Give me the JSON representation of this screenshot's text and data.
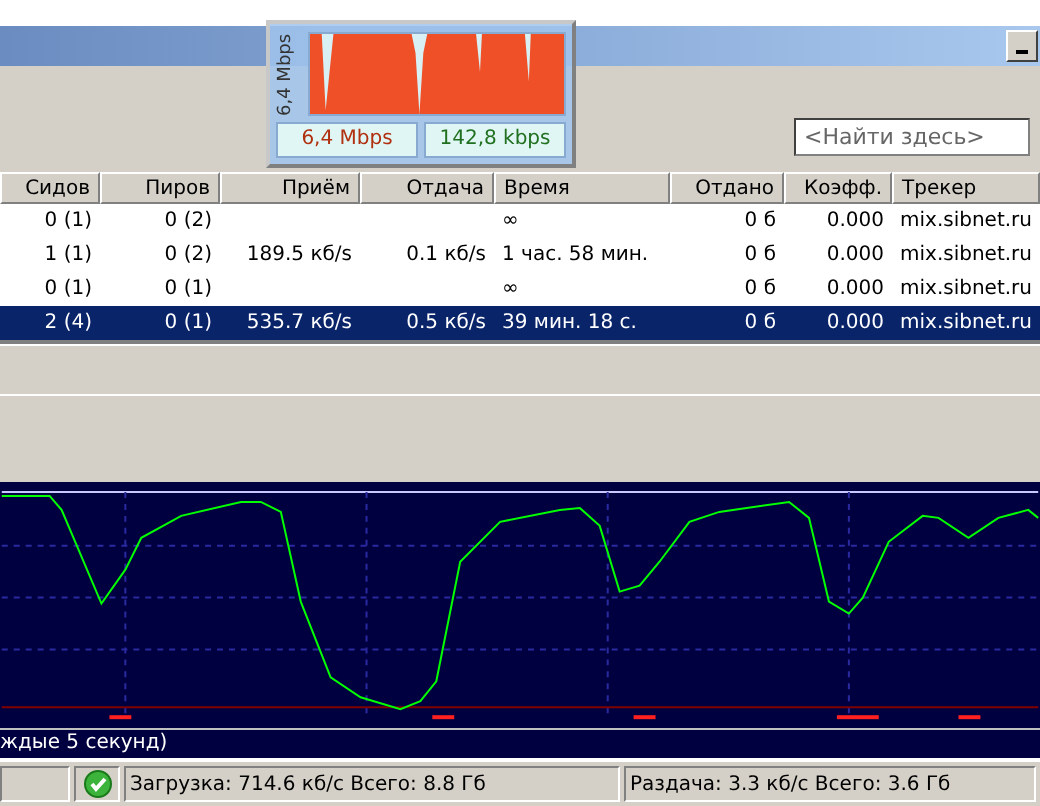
{
  "speed_widget": {
    "axis_label": "6,4 Mbps",
    "download": "6,4 Mbps",
    "upload": "142,8 kbps"
  },
  "search": {
    "placeholder": "<Найти здесь>"
  },
  "table": {
    "columns": [
      "Сидов",
      "Пиров",
      "Приём",
      "Отдача",
      "Время",
      "Отдано",
      "Коэфф.",
      "Трекер"
    ],
    "rows": [
      {
        "cells": [
          "0 (1)",
          "0 (2)",
          "",
          "",
          "∞",
          "0 б",
          "0.000",
          "mix.sibnet.ru"
        ],
        "selected": false
      },
      {
        "cells": [
          "1 (1)",
          "0 (2)",
          "189.5 кб/s",
          "0.1 кб/s",
          "1 час. 58 мин.",
          "0 б",
          "0.000",
          "mix.sibnet.ru"
        ],
        "selected": false
      },
      {
        "cells": [
          "0 (1)",
          "0 (1)",
          "",
          "",
          "∞",
          "0 б",
          "0.000",
          "mix.sibnet.ru"
        ],
        "selected": false
      },
      {
        "cells": [
          "2 (4)",
          "0 (1)",
          "535.7 кб/s",
          "0.5 кб/s",
          "39 мин. 18 с.",
          "0 б",
          "0.000",
          "mix.sibnet.ru"
        ],
        "selected": true
      }
    ]
  },
  "graph": {
    "caption": "ждые 5 секунд)"
  },
  "status_bar": {
    "download": "Загрузка: 714.6 кб/с Всего: 8.8 Гб",
    "upload": "Раздача: 3.3 кб/с Всего: 3.6 Гб"
  }
}
